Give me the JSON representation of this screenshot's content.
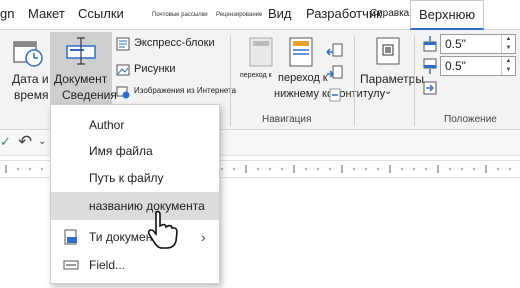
{
  "tabs": [
    {
      "label": "gn",
      "cls": ""
    },
    {
      "label": "Макет",
      "cls": ""
    },
    {
      "label": "Ссылки",
      "cls": ""
    },
    {
      "label": "Почтовые рассылки",
      "cls": "tiny"
    },
    {
      "label": "Рецензирование",
      "cls": "tiny"
    },
    {
      "label": "Вид",
      "cls": ""
    },
    {
      "label": "Разработчик",
      "cls": ""
    },
    {
      "label": "Справка",
      "cls": "tiny2"
    },
    {
      "label": "Верхнюю",
      "cls": "active"
    }
  ],
  "ribbon": {
    "date_time_line1": "Дата и",
    "date_time_line2": "время",
    "doc_info_line1": "Документ",
    "doc_info_line2": "Сведения",
    "quick_parts": "Экспресс-блоки",
    "pictures": "Рисунки",
    "online_pictures": "Изображения из Интернета",
    "goto_header": "переход к",
    "goto_footer_line1": "переход к",
    "goto_footer_line2": "нижнему колонтитулу",
    "navigation_group": "Навигация",
    "options": "Параметры",
    "position_group": "Положение",
    "header_pos": "0.5\"",
    "footer_pos": "0.5\""
  },
  "menu": {
    "items": [
      {
        "label": "Author",
        "highlight": false
      },
      {
        "label": "Имя файла",
        "highlight": false
      },
      {
        "label": "Путь к файлу",
        "highlight": false
      },
      {
        "label": "названию документа",
        "highlight": true
      },
      {
        "label": "Ти документов",
        "highlight": false
      },
      {
        "label": "Field...",
        "highlight": false
      }
    ]
  },
  "colors": {
    "accent": "#2f6fc7",
    "icon_blue": "#2f6fc7",
    "highlight": "#dcdcdc",
    "ribbon_bg": "#f3f3f3"
  }
}
